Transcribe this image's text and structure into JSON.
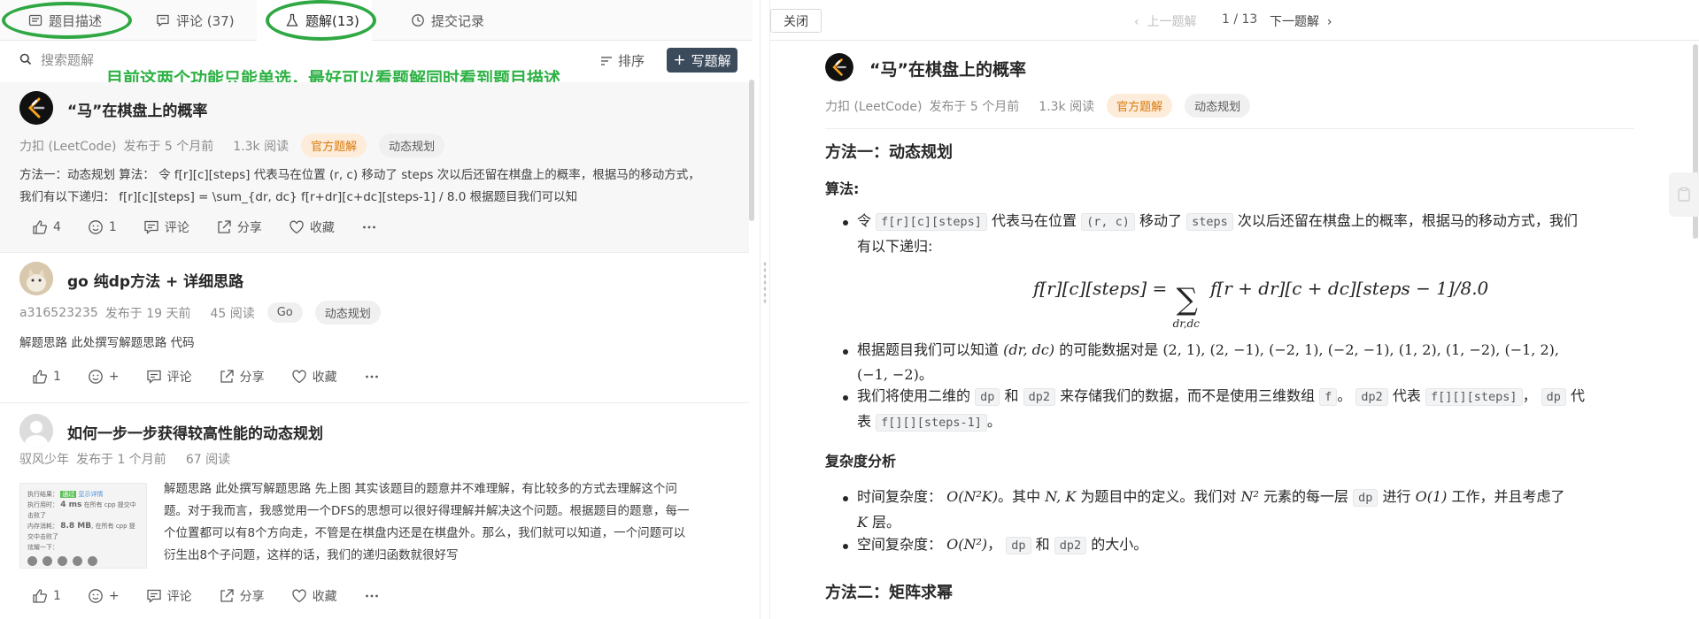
{
  "tabs": [
    {
      "label": "题目描述"
    },
    {
      "label": "评论 (37)"
    },
    {
      "label": "题解(13)"
    },
    {
      "label": "提交记录"
    }
  ],
  "search": {
    "placeholder": "搜索题解"
  },
  "toolbar": {
    "sort_label": "排序",
    "write_label": "写题解"
  },
  "annotation": "目前这两个功能只能单选，最好可以看题解同时看到题目描述",
  "solutions": [
    {
      "title": "“马”在棋盘上的概率",
      "author": "力扣 (LeetCode)",
      "posted": "发布于 5 个月前",
      "views": "1.3k 阅读",
      "tags": [
        "官方题解",
        "动态规划"
      ],
      "excerpt_1": "方法一：动态规划 算法： 令 f[r][c][steps] 代表马在位置 (r, c) 移动了 steps 次以后还留在棋盘上的概率，根据马的移动方式，",
      "excerpt_2": "我们有以下递归：  f[r][c][steps] = \\sum_{dr, dc} f[r+dr][c+dc][steps-1] / 8.0 根据题目我们可以知",
      "likes": "4",
      "reactions": "1"
    },
    {
      "title": "go 纯dp方法 + 详细思路",
      "author": "a316523235",
      "posted": "发布于 19 天前",
      "views": "45 阅读",
      "tags": [
        "Go",
        "动态规划"
      ],
      "excerpt_1": "解题思路 此处撰写解题思路 代码",
      "likes": "1",
      "reactions": "+"
    },
    {
      "title": "如何一步一步获得较高性能的动态规划",
      "author": "驭风少年",
      "posted": "发布于 1 个月前",
      "views": "67 阅读",
      "excerpt_1": "解题思路 此处撰写解题思路 先上图 其实该题目的题意并不难理解，有比较多的方式去理解这个问",
      "excerpt_2": "题。对于我而言，我感觉用一个DFS的思想可以很好得理解并解决这个问题。根据题目的题意，每一",
      "excerpt_3": "个位置都可以有8个方向走，不管是在棋盘内还是在棋盘外。那么，我们就可以知道，一个问题可以",
      "excerpt_4": "衍生出8个子问题，这样的话，我们的递归函数就很好写",
      "likes": "1",
      "reactions": "+"
    }
  ],
  "actions": {
    "comment": "评论",
    "share": "分享",
    "favorite": "收藏"
  },
  "thumb_text": {
    "r1": "执行结果：",
    "r1b": "通过",
    "r1c": "显示详情",
    "r2": "执行用时：",
    "r2b": "4 ms",
    "r2c": "在所有 cpp 提交中击败了",
    "r3": "内存消耗：",
    "r3b": "8.8 MB",
    "r3c": ", 在所有 cpp 提交中击败了",
    "r4": "炫耀一下："
  },
  "detail_nav": {
    "close": "关闭",
    "prev": "上一题解",
    "pager": "1 / 13",
    "next": "下一题解"
  },
  "article": {
    "title": "“马”在棋盘上的概率",
    "author": "力扣 (LeetCode)",
    "posted": "发布于 5 个月前",
    "views": "1.3k 阅读",
    "tags": [
      "官方题解",
      "动态规划"
    ],
    "method1": "方法一：动态规划",
    "algo": "算法:",
    "b1_a": "令",
    "b1_code1": "f[r][c][steps]",
    "b1_b": "代表马在位置",
    "b1_pos": "(r,  c)",
    "b1_c": "移动了",
    "b1_code2": "steps",
    "b1_d": "次以后还留在棋盘上的概率，根据马的移动方式，我们",
    "b1_line2": "有以下递归:",
    "formula_left": "f[r][c][steps] =",
    "formula_right": "f[r + dr][c + dc][steps − 1]/8.0",
    "formula_sub": "dr,dc",
    "b2_a": "根据题目我们可以知道",
    "b2_math": "(dr, dc)",
    "b2_b": "的可能数据对是",
    "b2_pairs": "(2, 1), (2, −1), (−2, 1), (−2, −1), (1, 2), (1, −2), (−1, 2),",
    "b2_pairs2": "(−1, −2)",
    "b2_end": "。",
    "b3_a": "我们将使用二维的",
    "b3_code1": "dp",
    "b3_b": "和",
    "b3_code2": "dp2",
    "b3_c": "来存储我们的数据，而不是使用三维数组",
    "b3_code3": "f",
    "b3_d": "。",
    "b3_code4": "dp2",
    "b3_e": "代表",
    "b3_code5": "f[][][steps]",
    "b3_f": "，",
    "b3_code6": "dp",
    "b3_g": "代",
    "b3_line2a": "表",
    "b3_code7": "f[][][steps-1]",
    "b3_line2b": "。",
    "complexity": "复杂度分析",
    "c1_a": "时间复杂度：",
    "c1_math": "O(N²K)",
    "c1_b": "。其中",
    "c1_math2": "N, K",
    "c1_c": "为题目中的定义。我们对",
    "c1_math3": "N²",
    "c1_d": "元素的每一层",
    "c1_code": "dp",
    "c1_e": "进行",
    "c1_math4": "O(1)",
    "c1_f": "工作，并且考虑了",
    "c1_line2_math": "K",
    "c1_line2": "层。",
    "c2_a": "空间复杂度：",
    "c2_math": "O(N²)",
    "c2_b": "，",
    "c2_code1": "dp",
    "c2_c": "和",
    "c2_code2": "dp2",
    "c2_d": "的大小。",
    "method2": "方法二：矩阵求幂"
  },
  "colors": {
    "accent_green": "#2fb245",
    "write_btn": "#3c4b5c",
    "official_tag": "#d9790a"
  }
}
